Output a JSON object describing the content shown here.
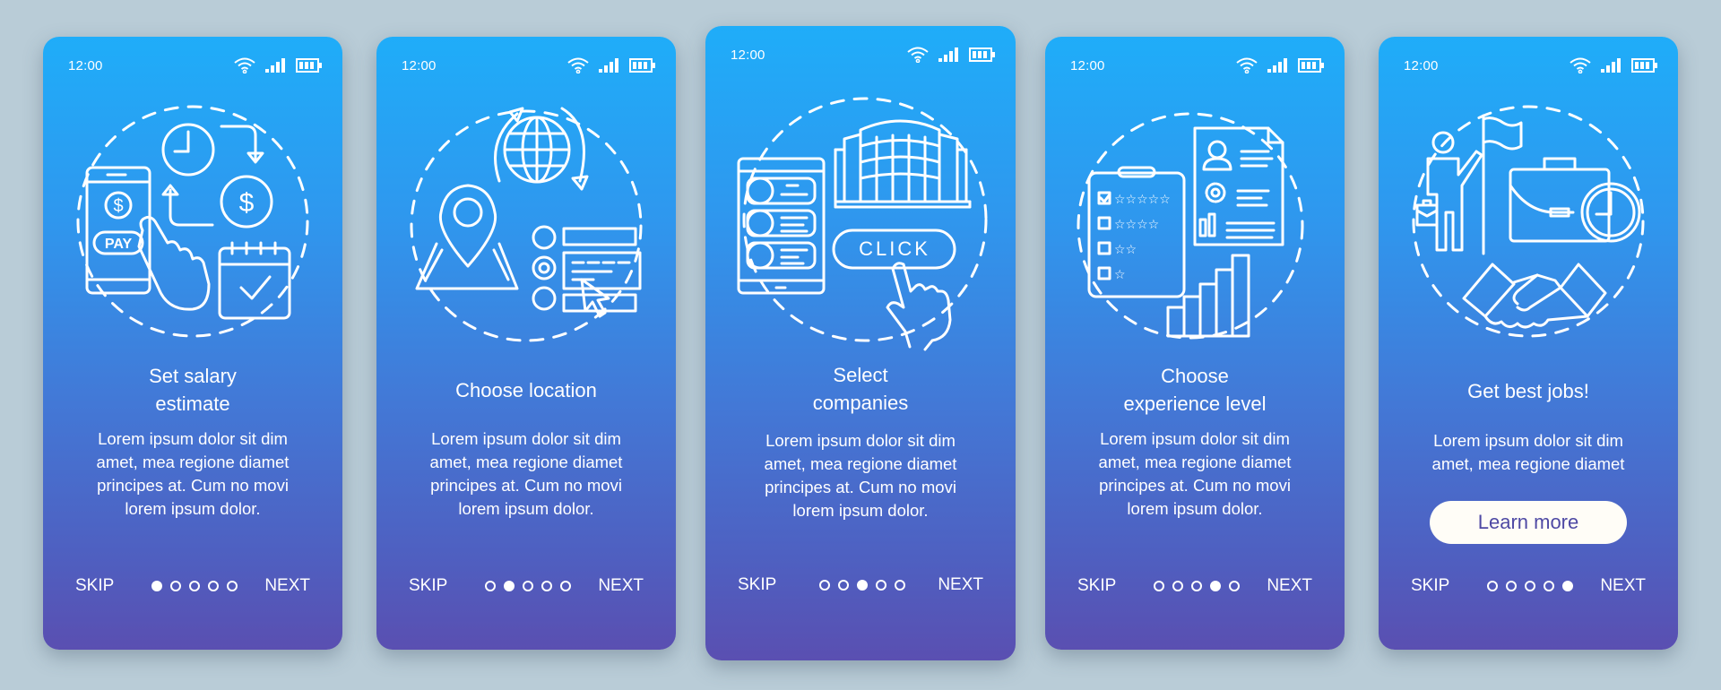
{
  "colors": {
    "background": "#b9ccd7",
    "gradient_top": "#1fadf9",
    "gradient_bottom": "#5a4fb1",
    "button_text": "#4e49a4",
    "button_bg": "#fffdf7"
  },
  "status_bar": {
    "time": "12:00",
    "icons": [
      "wifi-icon",
      "signal-icon",
      "battery-icon"
    ]
  },
  "nav": {
    "skip_label": "SKIP",
    "next_label": "NEXT",
    "total_pages": 5
  },
  "screens": [
    {
      "illustration": "salary-payment-illustration",
      "title_line1": "Set salary",
      "title_line2": "estimate",
      "body": [
        "Lorem ipsum dolor sit dim",
        "amet, mea regione diamet",
        "principes at. Cum no movi",
        "lorem ipsum dolor."
      ],
      "active_page": 1,
      "pay_label": "PAY"
    },
    {
      "illustration": "location-globe-illustration",
      "title_line1": "Choose location",
      "title_line2": "",
      "body": [
        "Lorem ipsum dolor sit dim",
        "amet, mea regione diamet",
        "principes at. Cum no movi",
        "lorem ipsum dolor."
      ],
      "active_page": 2
    },
    {
      "illustration": "company-select-illustration",
      "title_line1": "Select",
      "title_line2": "companies",
      "body": [
        "Lorem ipsum dolor sit dim",
        "amet, mea regione diamet",
        "principes at. Cum no movi",
        "lorem ipsum dolor."
      ],
      "active_page": 3,
      "click_label": "CLICK"
    },
    {
      "illustration": "experience-rating-illustration",
      "title_line1": "Choose",
      "title_line2": "experience level",
      "body": [
        "Lorem ipsum dolor sit dim",
        "amet, mea regione diamet",
        "principes at. Cum no movi",
        "lorem ipsum dolor."
      ],
      "active_page": 4
    },
    {
      "illustration": "best-jobs-illustration",
      "title_line1": "Get best jobs!",
      "title_line2": "",
      "body": [
        "Lorem ipsum dolor sit dim",
        "amet, mea regione diamet"
      ],
      "active_page": 5,
      "button_label": "Learn more"
    }
  ]
}
